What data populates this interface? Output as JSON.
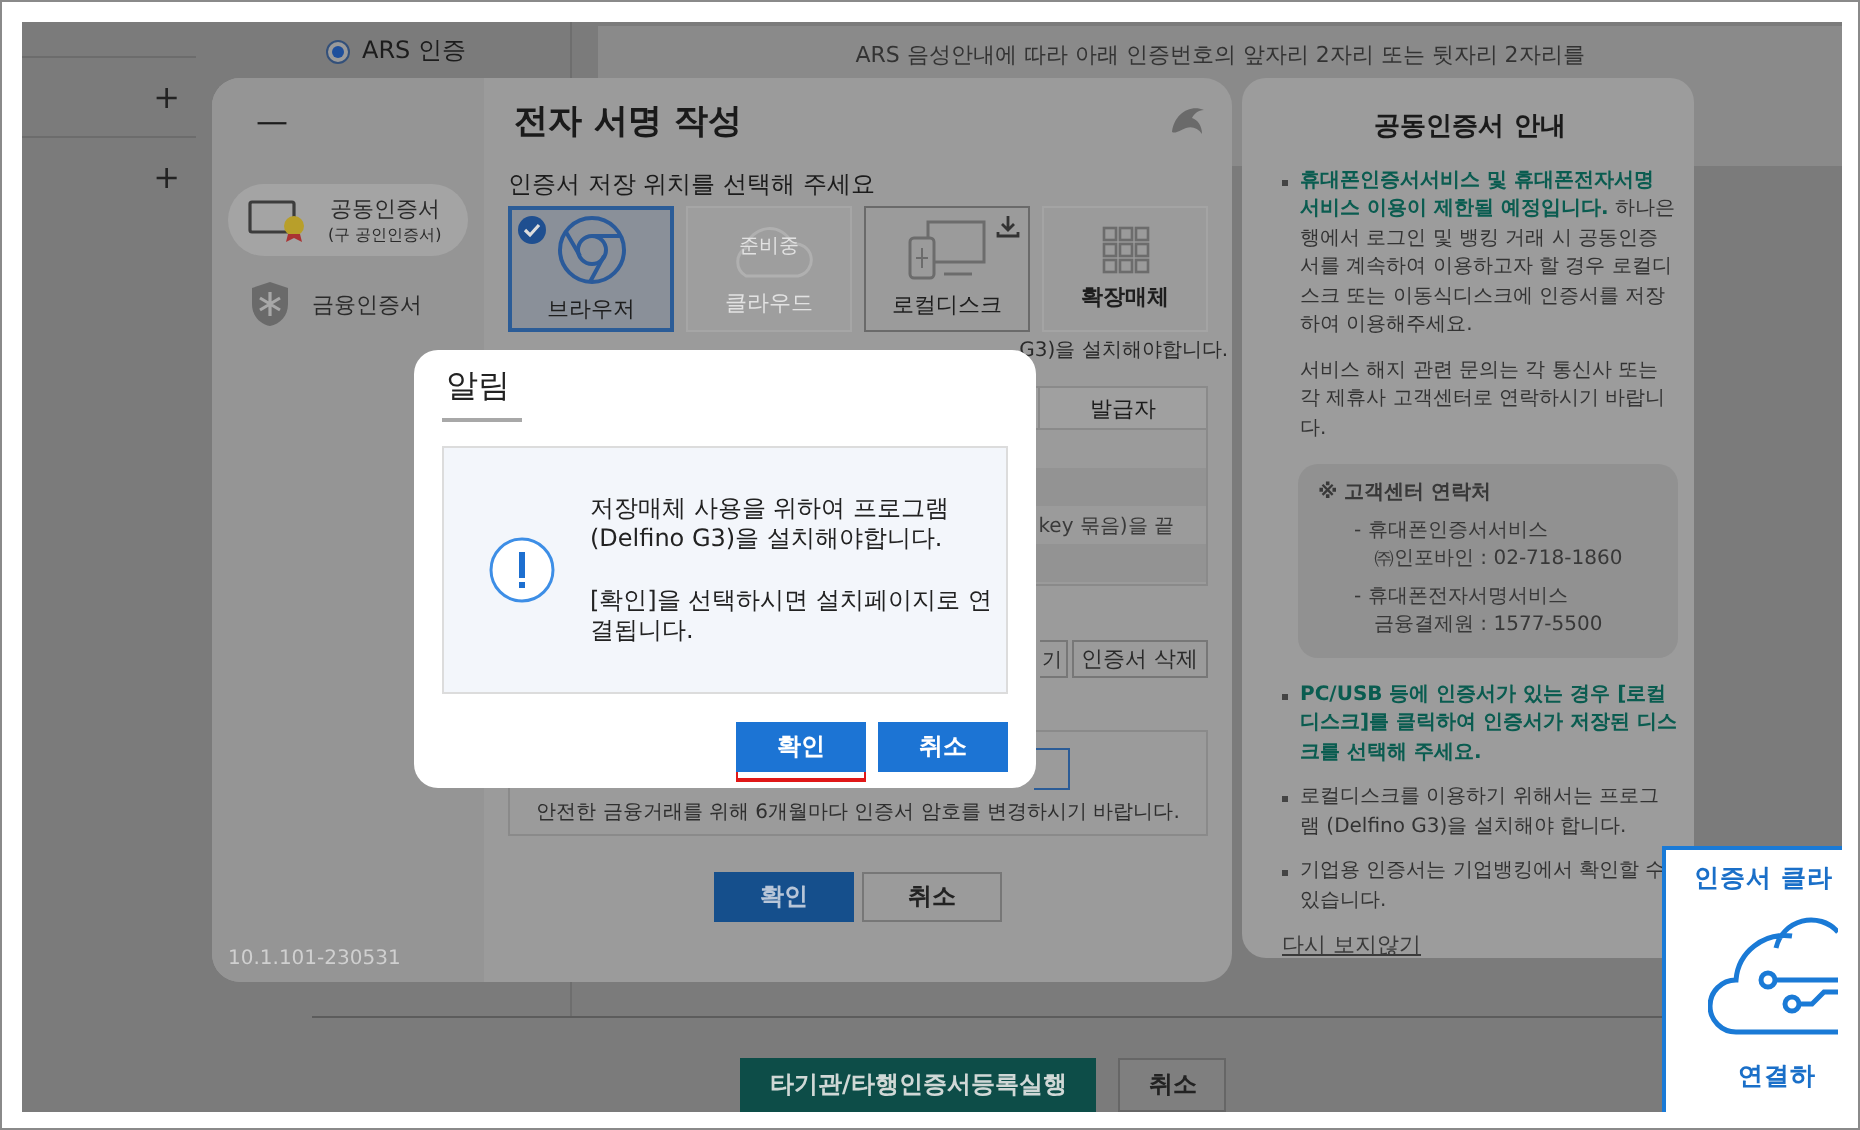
{
  "background_page": {
    "expand_buttons": [
      "+",
      "+"
    ],
    "auth_option": {
      "label": "ARS 인증",
      "selected": true
    },
    "notice": "ARS 음성안내에 따라 아래 인증번호의 앞자리 2자리 또는 뒷자리 2자리를",
    "footer_buttons": [
      {
        "label": "타기관/타행인증서등록실행",
        "kind": "primary"
      },
      {
        "label": "취소",
        "kind": "secondary"
      }
    ]
  },
  "sign_dialog": {
    "minimize": "—",
    "nav": [
      {
        "label": "공동인증서",
        "sublabel": "(구 공인인증서)",
        "kind": "joint",
        "selected": true
      },
      {
        "label": "금융인증서",
        "kind": "financial",
        "selected": false
      }
    ],
    "version": "10.1.101-230531",
    "title": "전자 서명 작성",
    "storage_prompt": "인증서 저장 위치를 선택해 주세요",
    "storage": [
      {
        "label": "브라우저",
        "kind": "browser",
        "selected": true,
        "disabled": false
      },
      {
        "label": "클라우드",
        "badge": "준비중",
        "kind": "cloud",
        "selected": false,
        "disabled": true
      },
      {
        "label": "로컬디스크",
        "kind": "local",
        "selected": false,
        "disabled": false
      },
      {
        "label": "확장매체",
        "kind": "extended",
        "selected": false,
        "disabled": false
      }
    ],
    "install_notice": "G3)을 설치해야합니다.",
    "table": {
      "columns": [
        "발급자"
      ],
      "row_text": "key 묶음)을 끝"
    },
    "cert_buttons": [
      "기",
      "인증서 삭제"
    ],
    "password_note": "안전한 금융거래를 위해 6개월마다 인증서 암호를 변경하시기 바랍니다.",
    "buttons": [
      {
        "label": "확인",
        "kind": "primary"
      },
      {
        "label": "취소",
        "kind": "secondary"
      }
    ]
  },
  "info_panel": {
    "title": "공동인증서 안내",
    "items": [
      {
        "kind": "bullet",
        "highlight": "휴대폰인증서서비스 및 휴대폰전자서명 서비스 이용이 제한될 예정입니다.",
        "text": "하나은행에서 로그인 및 뱅킹 거래 시 공동인증서를 계속하여 이용하고자 할 경우 로컬디스크 또는 이동식디스크에 인증서를 저장하여 이용해주세요."
      },
      {
        "kind": "paragraph",
        "text": "서비스 해지 관련 문의는 각 통신사 또는 각 제휴사 고객센터로 연락하시기 바랍니다."
      },
      {
        "kind": "contact",
        "title": "※ 고객센터 연락처",
        "entries": [
          {
            "name": "- 휴대폰인증서서비스",
            "detail": "㈜인포바인 : 02-718-1860"
          },
          {
            "name": "- 휴대폰전자서명서비스",
            "detail": "금융결제원 : 1577-5500"
          }
        ]
      },
      {
        "kind": "bullet",
        "highlight": "PC/USB 등에 인증서가 있는 경우 [로컬디스크]를 클릭하여 인증서가 저장된 디스크를 선택해 주세요."
      },
      {
        "kind": "bullet",
        "text": "로컬디스크를 이용하기 위해서는 프로그램 (Delfino G3)을 설치해야 합니다."
      },
      {
        "kind": "bullet",
        "text": "기업용 인증서는 기업뱅킹에서 확인할 수 있습니다."
      }
    ],
    "link": "다시 보지않기"
  },
  "alert": {
    "title": "알림",
    "message": [
      "저장매체 사용을 위하여 프로그램 (Delfino G3)을 설치해야합니다.",
      "[확인]을 선택하시면 설치페이지로 연결됩니다."
    ],
    "buttons": [
      {
        "label": "확인",
        "kind": "primary",
        "focused": true
      },
      {
        "label": "취소",
        "kind": "primary",
        "focused": false
      }
    ]
  },
  "side_widget": {
    "title": "인증서 클라",
    "action": "연결하"
  }
}
